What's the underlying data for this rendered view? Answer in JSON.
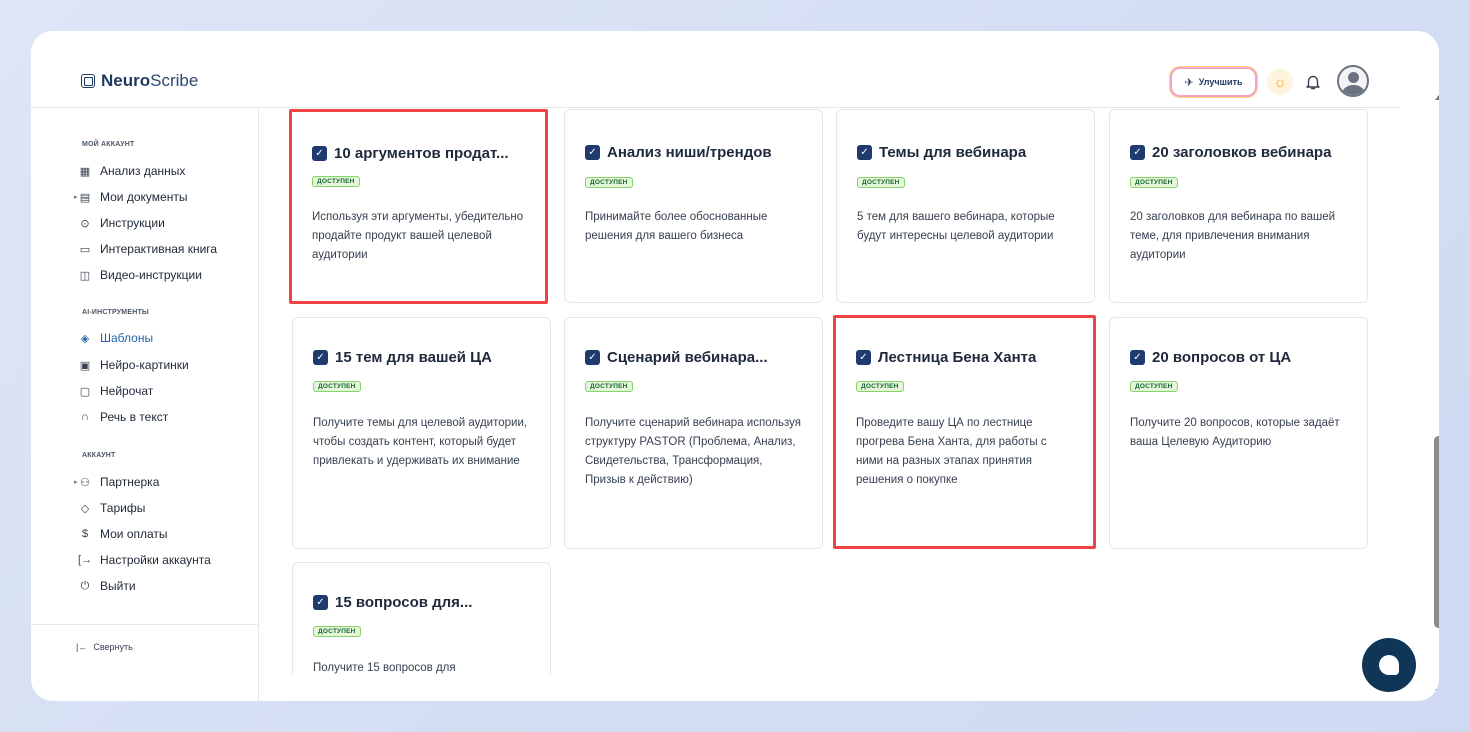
{
  "header": {
    "logo_bold": "Neuro",
    "logo_light": "Scribe",
    "upgrade_label": "Улучшить"
  },
  "sidebar": {
    "section_my_account": "МОЙ АККАУНТ",
    "section_ai_tools": "AI-ИНСТРУМЕНТЫ",
    "section_account": "АККАУНТ",
    "items": [
      {
        "label": "Анализ данных",
        "icon": "grid-icon"
      },
      {
        "label": "Мои документы",
        "icon": "document-icon"
      },
      {
        "label": "Инструкции",
        "icon": "help-icon"
      },
      {
        "label": "Интерактивная книга",
        "icon": "book-icon"
      },
      {
        "label": "Видео-инструкции",
        "icon": "video-icon"
      },
      {
        "label": "Шаблоны",
        "icon": "layers-icon"
      },
      {
        "label": "Нейро-картинки",
        "icon": "image-icon"
      },
      {
        "label": "Нейрочат",
        "icon": "chat-icon"
      },
      {
        "label": "Речь в текст",
        "icon": "headphones-icon"
      },
      {
        "label": "Партнерка",
        "icon": "users-icon"
      },
      {
        "label": "Тарифы",
        "icon": "tag-icon"
      },
      {
        "label": "Мои оплаты",
        "icon": "dollar-icon"
      },
      {
        "label": "Настройки аккаунта",
        "icon": "login-icon"
      },
      {
        "label": "Выйти",
        "icon": "power-icon"
      }
    ],
    "collapse_label": "Свернуть"
  },
  "cards": [
    {
      "title": "10 аргументов продат...",
      "badge": "ДОСТУПЕН",
      "desc": "Используя эти аргументы, убедительно продайте продукт вашей целевой аудитории"
    },
    {
      "title": "Анализ ниши/трендов",
      "badge": "ДОСТУПЕН",
      "desc": "Принимайте более обоснованные решения для вашего бизнеса"
    },
    {
      "title": "Темы для вебинара",
      "badge": "ДОСТУПЕН",
      "desc": "5 тем для вашего вебинара, которые будут интересны целевой аудитории"
    },
    {
      "title": "20 заголовков вебинара",
      "badge": "ДОСТУПЕН",
      "desc": "20 заголовков для вебинара по вашей теме, для привлечения внимания аудитории"
    },
    {
      "title": "15 тем для вашей ЦА",
      "badge": "ДОСТУПЕН",
      "desc": "Получите темы для целевой аудитории, чтобы создать контент, который будет привлекать и удерживать их внимание"
    },
    {
      "title": "Сценарий вебинара...",
      "badge": "ДОСТУПЕН",
      "desc": "Получите сценарий вебинара используя структуру PASTOR (Проблема, Анализ, Свидетельства, Трансформация, Призыв к действию)"
    },
    {
      "title": "Лестница Бена Ханта",
      "badge": "ДОСТУПЕН",
      "desc": "Проведите вашу ЦА по лестнице прогрева Бена Ханта, для работы с ними на разных этапах принятия решения о покупке"
    },
    {
      "title": "20 вопросов от ЦА",
      "badge": "ДОСТУПЕН",
      "desc": "Получите 20 вопросов, которые задаёт ваша Целевую Аудиторию"
    },
    {
      "title": "15 вопросов для...",
      "badge": "ДОСТУПЕН",
      "desc": "Получите 15 вопросов для"
    }
  ]
}
